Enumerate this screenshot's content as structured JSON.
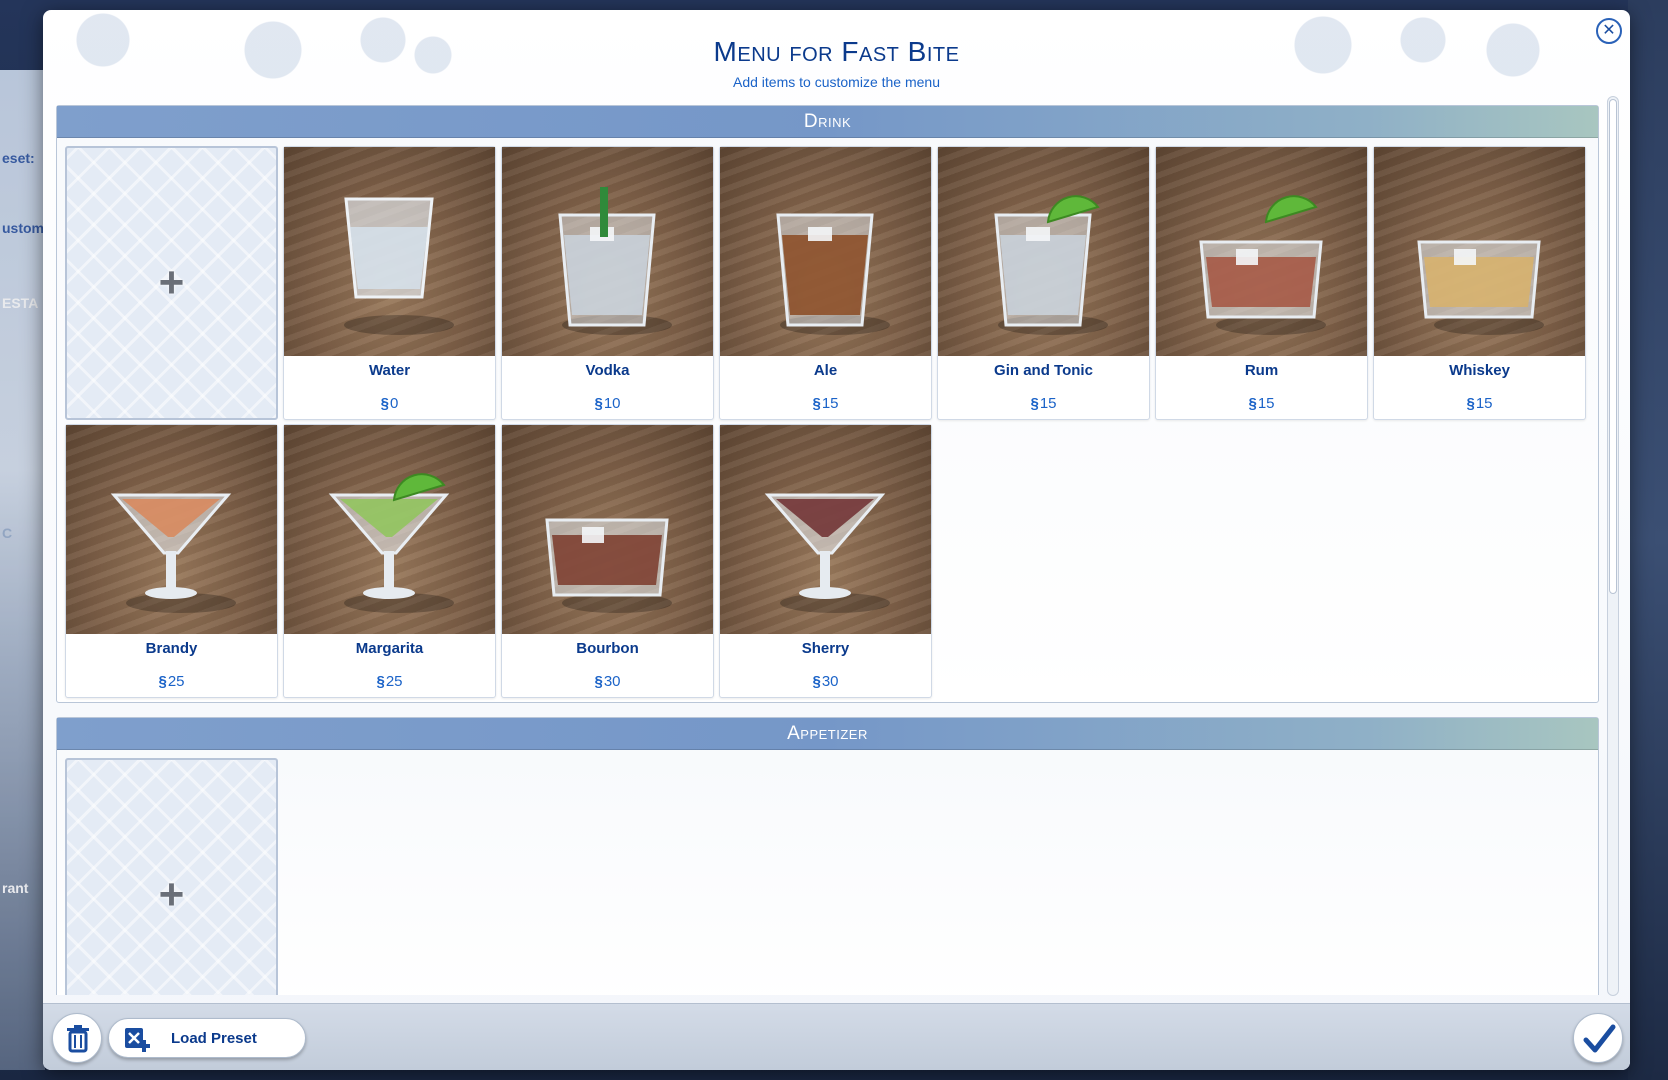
{
  "dialog": {
    "title": "Menu for Fast Bite",
    "subtitle": "Add items to customize the menu",
    "close_icon": "close-icon"
  },
  "sections": [
    {
      "header": "Drink",
      "items": [
        {
          "name": "Water",
          "price": "0",
          "glass": "tumbler",
          "liquid": "#d6e2ee",
          "garnish": "none"
        },
        {
          "name": "Vodka",
          "price": "10",
          "glass": "tall",
          "liquid": "#c9d2dc",
          "garnish": "stirrer"
        },
        {
          "name": "Ale",
          "price": "15",
          "glass": "tall",
          "liquid": "#8a4a22",
          "garnish": "none"
        },
        {
          "name": "Gin and Tonic",
          "price": "15",
          "glass": "tall",
          "liquid": "#c9d2dc",
          "garnish": "lime"
        },
        {
          "name": "Rum",
          "price": "15",
          "glass": "rocks",
          "liquid": "#a5533f",
          "garnish": "lime"
        },
        {
          "name": "Whiskey",
          "price": "15",
          "glass": "rocks",
          "liquid": "#d8b26a",
          "garnish": "none"
        },
        {
          "name": "Brandy",
          "price": "25",
          "glass": "martini",
          "liquid": "#d9875a",
          "garnish": "none"
        },
        {
          "name": "Margarita",
          "price": "25",
          "glass": "martini",
          "liquid": "#8fc65a",
          "garnish": "lime"
        },
        {
          "name": "Bourbon",
          "price": "30",
          "glass": "rocks",
          "liquid": "#7a3a2a",
          "garnish": "none"
        },
        {
          "name": "Sherry",
          "price": "30",
          "glass": "martini",
          "liquid": "#6e2e30",
          "garnish": "none"
        }
      ]
    },
    {
      "header": "Appetizer",
      "items": []
    }
  ],
  "currency_symbol": "§",
  "footer": {
    "delete_icon": "trash-icon",
    "load_preset_label": "Load Preset",
    "load_preset_icon": "load-preset-icon",
    "confirm_icon": "checkmark-icon"
  },
  "colors": {
    "title": "#0b3a8c",
    "accent": "#1b63c8",
    "header_bar": "#7f9fcc"
  }
}
